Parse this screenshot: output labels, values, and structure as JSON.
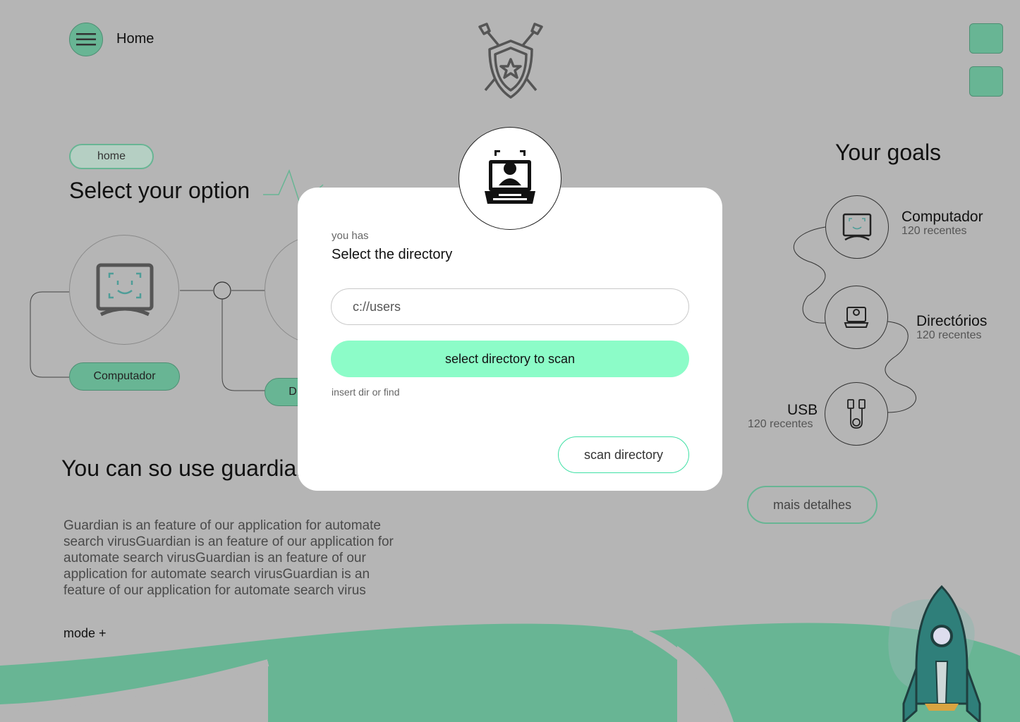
{
  "header": {
    "title": "Home",
    "menu_icon": "hamburger-icon",
    "logo_icon": "shield-swords-icon"
  },
  "breadcrumb": {
    "label": "home"
  },
  "main": {
    "heading": "Select your option",
    "options": [
      {
        "label": "Computador",
        "icon": "monitor-smile-icon"
      },
      {
        "label": "D",
        "icon": "laptop-user-icon"
      }
    ],
    "use_heading": "You can so use guardian",
    "description": "Guardian is an feature of our application for automate search virusGuardian is an feature of our application for automate search virusGuardian is an feature of our application for automate search virusGuardian is an feature of our application for automate search virus",
    "more_link": "mode +"
  },
  "goals": {
    "title": "Your goals",
    "items": [
      {
        "name": "Computador",
        "count": "120 recentes",
        "icon": "monitor-icon"
      },
      {
        "name": "Directórios",
        "count": "120 recentes",
        "icon": "laptop-icon"
      },
      {
        "name": "USB",
        "count": "120 recentes",
        "icon": "usb-cable-icon"
      }
    ],
    "details_button": "mais detalhes"
  },
  "modal": {
    "subtitle": "you has",
    "title": "Select the directory",
    "input_value": "c://users",
    "primary_button": "select directory to scan",
    "hint": "insert dir or find",
    "secondary_button": "scan directory",
    "badge_icon": "laptop-user-icon"
  },
  "colors": {
    "background": "#b5b5b5",
    "accent": "#68b594",
    "primary_button": "#8cfcc8",
    "modal_bg": "#ffffff"
  }
}
